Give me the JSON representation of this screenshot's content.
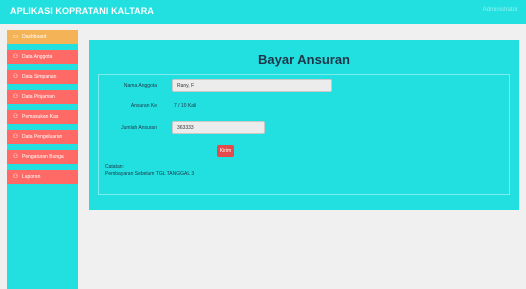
{
  "app": {
    "title": "APLIKASI KOPRATANI KALTARA",
    "user_menu": "Administrator"
  },
  "sidebar": {
    "items": [
      {
        "label": "Dashboard",
        "icon": "dashboard-icon",
        "active": true
      },
      {
        "label": "Data Anggota",
        "icon": "users-icon",
        "active": false
      },
      {
        "label": "Data Simpanan",
        "icon": "users-icon",
        "active": false
      },
      {
        "label": "Data Pinjaman",
        "icon": "users-icon",
        "active": false
      },
      {
        "label": "Pemasukan Kas",
        "icon": "users-icon",
        "active": false
      },
      {
        "label": "Data Pengeluaran",
        "icon": "users-icon",
        "active": false
      },
      {
        "label": "Pengaturan Bunga",
        "icon": "users-icon",
        "active": false
      },
      {
        "label": "Laporan",
        "icon": "users-icon",
        "active": false
      }
    ]
  },
  "main": {
    "title": "Bayar Ansuran",
    "form": {
      "nama_label": "Nama Anggota",
      "nama_value": "Rany, F",
      "ansuran_label": "Ansuran Ke",
      "ansuran_value": "7 / 10 Kali",
      "jumlah_label": "Jumlah Ansuran",
      "jumlah_value": "363333",
      "submit_label": "Kirim"
    },
    "note_title": "Catatan:",
    "note_text": "Pembayaran Sebelum TGL TANGGAL 3"
  },
  "colors": {
    "accent": "#22e0e0",
    "nav": "#ff6a66",
    "nav_active": "#f5b357",
    "button": "#e54b4b",
    "heading": "#1f3447"
  }
}
